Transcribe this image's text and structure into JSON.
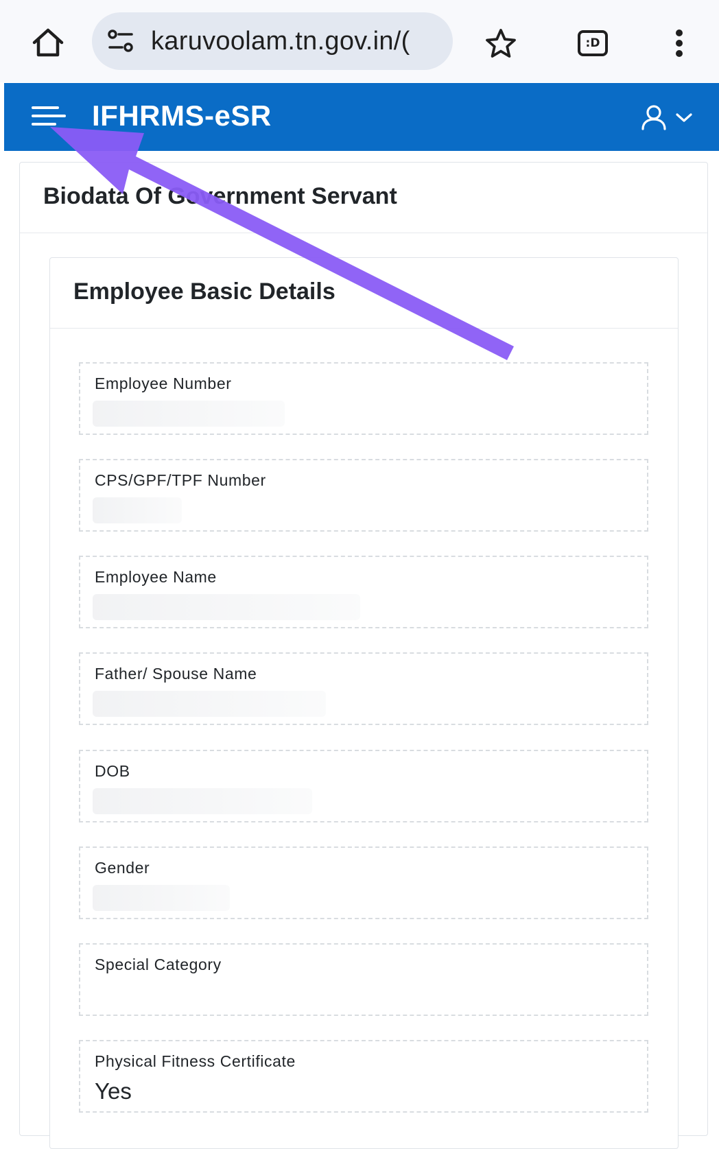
{
  "browser": {
    "url": "karuvoolam.tn.gov.in/(",
    "tabs_label": ":D",
    "icons": {
      "home": "home-icon",
      "site_settings": "tune-icon",
      "bookmark": "star-icon",
      "tabs": "tabs-icon",
      "menu": "more-vert-icon"
    }
  },
  "header": {
    "title": "IFHRMS-eSR",
    "bg_color": "#0a6cc6"
  },
  "page": {
    "title": "Biodata Of Government Servant"
  },
  "section": {
    "title": "Employee Basic Details"
  },
  "fields": [
    {
      "label": "Employee Number",
      "value": ""
    },
    {
      "label": "CPS/GPF/TPF Number",
      "value": ""
    },
    {
      "label": "Employee Name",
      "value": ""
    },
    {
      "label": "Father/ Spouse Name",
      "value": ""
    },
    {
      "label": "DOB",
      "value": ""
    },
    {
      "label": "Gender",
      "value": ""
    },
    {
      "label": "Special Category",
      "value": ""
    },
    {
      "label": "Physical Fitness Certificate",
      "value": "Yes"
    }
  ],
  "annotation": {
    "color": "#8a5cf6"
  }
}
